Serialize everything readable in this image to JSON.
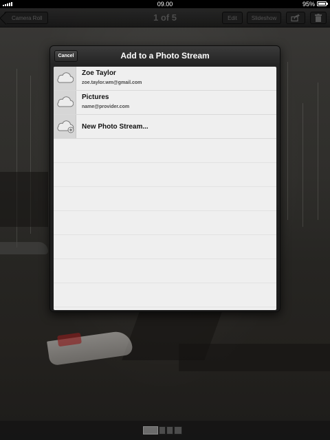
{
  "status_bar": {
    "time": "09.00",
    "battery": "95%"
  },
  "nav": {
    "back_label": "Camera Roll",
    "title": "1 of 5",
    "edit_label": "Edit",
    "slideshow_label": "Slideshow",
    "share_icon": "share-icon",
    "trash_icon": "trash-icon"
  },
  "popover": {
    "title": "Add to a Photo Stream",
    "cancel_label": "Cancel",
    "streams": [
      {
        "name": "Zoe Taylor",
        "email": "zoe.taylor.wm@gmail.com",
        "icon": "cloud-icon"
      },
      {
        "name": "Pictures",
        "email": "name@provider.com",
        "icon": "cloud-icon"
      }
    ],
    "new_stream_label": "New Photo Stream...",
    "new_stream_icon": "cloud-add-icon"
  },
  "colors": {
    "popover_bg": "#1c1c1c",
    "list_bg": "#efefef",
    "nav_text": "#4c4c4c"
  }
}
